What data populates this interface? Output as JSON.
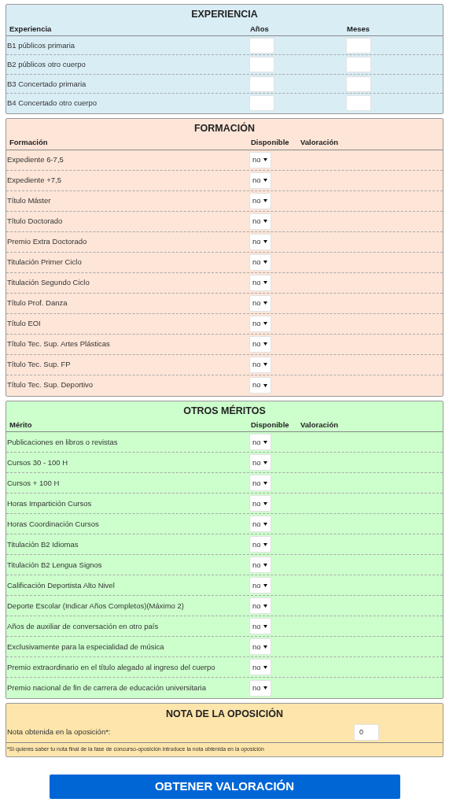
{
  "sections": [
    {
      "kind": "experience",
      "title": "EXPERIENCIA",
      "columns": [
        "Experiencia",
        "Años",
        "Meses"
      ],
      "rows": [
        {
          "label": "B1 públicos primaria"
        },
        {
          "label": "B2 públicos otro cuerpo"
        },
        {
          "label": "B3 Concertado primaria"
        },
        {
          "label": "B4 Concertado otro cuerpo"
        }
      ]
    },
    {
      "kind": "select",
      "title": "FORMACIÓN",
      "columns": [
        "Formación",
        "Disponible",
        "Valoración"
      ],
      "rows": [
        {
          "label": "Expediente 6-7,5",
          "value": "no"
        },
        {
          "label": "Expediente +7,5",
          "value": "no"
        },
        {
          "label": "Título Máster",
          "value": "no"
        },
        {
          "label": "Título Doctorado",
          "value": "no"
        },
        {
          "label": "Premio Extra Doctorado",
          "value": "no"
        },
        {
          "label": "Titulación Primer Ciclo",
          "value": "no"
        },
        {
          "label": "Titulación Segundo Ciclo",
          "value": "no"
        },
        {
          "label": "Título Prof. Danza",
          "value": "no"
        },
        {
          "label": "Título EOI",
          "value": "no"
        },
        {
          "label": "Título Tec. Sup. Artes Plásticas",
          "value": "no"
        },
        {
          "label": "Título Tec. Sup. FP",
          "value": "no"
        },
        {
          "label": "Título Tec. Sup. Deportivo",
          "value": "no"
        }
      ]
    },
    {
      "kind": "select",
      "title": "OTROS MÉRITOS",
      "columns": [
        "Mérito",
        "Disponible",
        "Valoración"
      ],
      "rows": [
        {
          "label": "Publicaciones en libros o revistas",
          "value": "no"
        },
        {
          "label": "Cursos 30 - 100 H",
          "value": "no"
        },
        {
          "label": "Cursos + 100 H",
          "value": "no"
        },
        {
          "label": "Horas Impartición Cursos",
          "value": "no"
        },
        {
          "label": "Horas Coordinación Cursos",
          "value": "no"
        },
        {
          "label": "Titulación B2 Idiomas",
          "value": "no"
        },
        {
          "label": "Titulación B2 Lengua Signos",
          "value": "no"
        },
        {
          "label": "Calificación Deportista Alto Nivel",
          "value": "no"
        },
        {
          "label": "Deporte Escolar (Indicar Años Completos)(Máximo 2)",
          "value": "no"
        },
        {
          "label": "Años de auxiliar de conversación en otro país",
          "value": "no"
        },
        {
          "label": "Exclusivamente para la especialidad de música",
          "value": "no"
        },
        {
          "label": "Premio extraordinario en el título alegado al ingreso del cuerpo",
          "value": "no"
        },
        {
          "label": "Premio nacional de fin de carrera de educación universitaria",
          "value": "no"
        }
      ]
    }
  ],
  "nota": {
    "title": "NOTA DE LA OPOSICIÓN",
    "label": "Nota obtenida en la oposición*:",
    "value": "0",
    "footnote": "*Si quieres saber tu nota final de la fase de concurso-oposición introduce la nota obtenida en la oposición"
  },
  "button": "OBTENER VALORACIÓN"
}
